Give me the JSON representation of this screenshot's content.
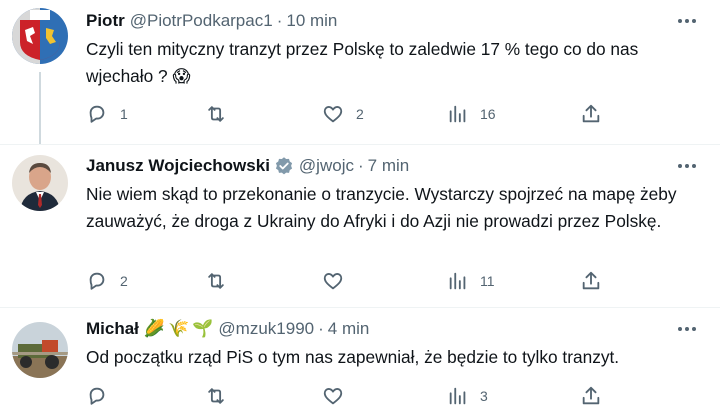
{
  "tweets": [
    {
      "name": "Piotr",
      "handle": "@PiotrPodkarpac1",
      "time": "10 min",
      "text": "Czyli ten mityczny tranzyt przez Polskę to zaledwie 17 % tego co do nas wjechało ? 😱",
      "replies": "1",
      "retweets": "",
      "likes": "2",
      "views": "16"
    },
    {
      "name": "Janusz Wojciechowski",
      "handle": "@jwojc",
      "time": "7 min",
      "verified": true,
      "text": "Nie wiem skąd to przekonanie o tranzycie. Wystarczy spojrzeć na mapę żeby zauważyć, że droga z Ukrainy do Afryki i do Azji nie prowadzi przez Polskę.",
      "replies": "2",
      "retweets": "",
      "likes": "",
      "views": "11"
    },
    {
      "name": "Michał",
      "handle": "@mzuk1990",
      "time": "4 min",
      "name_emojis": [
        "🌽",
        "🌾",
        "🌱"
      ],
      "text": "Od początku rząd PiS o tym nas zapewniał, że będzie to tylko tranzyt.",
      "replies": "",
      "retweets": "",
      "likes": "",
      "views": "3"
    }
  ],
  "colors": {
    "text": "#0f1419",
    "secondary": "#536471",
    "divider": "#eff3f4",
    "verified": "#829aab"
  },
  "icons": [
    "reply-icon",
    "retweet-icon",
    "like-icon",
    "views-icon",
    "share-icon",
    "more-icon",
    "verified-badge-icon"
  ]
}
